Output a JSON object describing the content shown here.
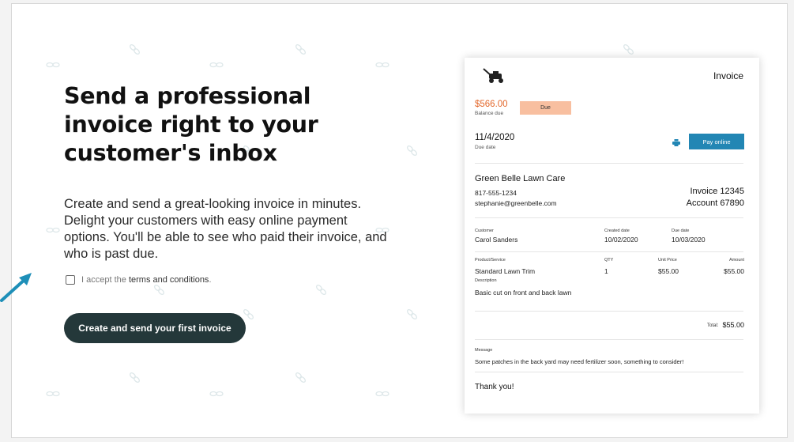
{
  "hero": {
    "headline": "Send a professional invoice right to your customer's inbox",
    "body": "Create and send a great-looking invoice in minutes. Delight your customers with easy online payment options. You'll be able to see who paid their invoice, and who is past due.",
    "terms_prefix": "I accept the ",
    "terms_link": "terms and conditions",
    "terms_suffix": ".",
    "cta_label": "Create and send your first invoice"
  },
  "invoice": {
    "title": "Invoice",
    "balance_amount": "$566.00",
    "balance_label": "Balance due",
    "status": "Due",
    "due_date": "11/4/2020",
    "due_date_label": "Due date",
    "pay_label": "Pay online",
    "company": "Green Belle Lawn Care",
    "phone": "817-555-1234",
    "email": "stephanie@greenbelle.com",
    "invoice_number": "Invoice 12345",
    "account_number": "Account 67890",
    "meta_headers": [
      "Customer",
      "Created date",
      "Due date"
    ],
    "meta_values": [
      "Carol Sanders",
      "10/02/2020",
      "10/03/2020"
    ],
    "item_headers": [
      "Product/Service",
      "QTY",
      "Unit Price",
      "Amount"
    ],
    "item": {
      "product": "Standard Lawn Trim",
      "qty": "1",
      "unit_price": "$55.00",
      "amount": "$55.00"
    },
    "description_label": "Description",
    "description": "Basic cut on front and back lawn",
    "total_label": "Total:",
    "total": "$55.00",
    "message_label": "Message",
    "message": "Some patches in the back yard may need fertilizer soon, something to consider!",
    "thanks": "Thank you!"
  },
  "colors": {
    "cta_bg": "#24383a",
    "balance": "#e3672a",
    "due_badge": "#f8bfa0",
    "pay_button": "#2286b4",
    "arrow": "#1e8fb8"
  },
  "icons": [
    "lawn-mower-icon",
    "print-icon",
    "arrow-pointer-icon",
    "checkbox"
  ]
}
